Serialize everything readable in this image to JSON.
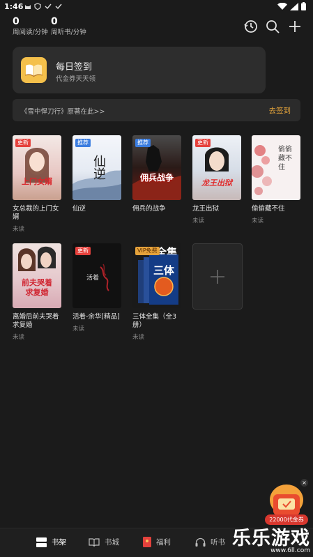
{
  "status_bar": {
    "time": "1:46"
  },
  "stats": [
    {
      "value": "0",
      "label": "周阅读/分钟"
    },
    {
      "value": "0",
      "label": "周听书/分钟"
    }
  ],
  "signin": {
    "title": "每日签到",
    "subtitle": "代金券天天领"
  },
  "banner": {
    "text": "《雪中悍刀行》原著在此>>",
    "action": "去签到"
  },
  "books": [
    {
      "title": "女总裁的上门女婿",
      "tag": "更新",
      "status": "未读"
    },
    {
      "title": "仙逆",
      "tag": "推荐",
      "status": ""
    },
    {
      "title": "佣兵的战争",
      "tag": "推荐",
      "status": ""
    },
    {
      "title": "龙王出狱",
      "tag": "更新",
      "status": "未读"
    },
    {
      "title": "偷偷藏不住",
      "tag": "",
      "status": "未读"
    },
    {
      "title": "离婚后前夫哭着求复婚",
      "tag": "",
      "status": "未读"
    },
    {
      "title": "活着-余华[精品]",
      "tag": "更新",
      "status": "未读"
    },
    {
      "title": "三体全集（全3册）",
      "tag": "VIP免费",
      "status": "未读"
    }
  ],
  "covers": {
    "b0": "上门女婿",
    "b1": "仙逆",
    "b2": "佣兵战争",
    "b3": "龙王出狱",
    "b4": "偷偷藏不住",
    "b5": "前夫哭着求复婚",
    "b6": "活着",
    "b7a": "全集",
    "b7b": "三体"
  },
  "promo": {
    "label": "22000代金券"
  },
  "nav": [
    {
      "label": "书架"
    },
    {
      "label": "书城"
    },
    {
      "label": "福利"
    },
    {
      "label": "听书"
    }
  ],
  "watermark": {
    "main": "乐乐游戏",
    "url": "www.6ll.com"
  },
  "colors": {
    "accent": "#e6a53b",
    "background": "#1b1b1b",
    "card": "#2d2d2d",
    "tag_new": "#e5413c",
    "tag_rec": "#3b7de0"
  }
}
